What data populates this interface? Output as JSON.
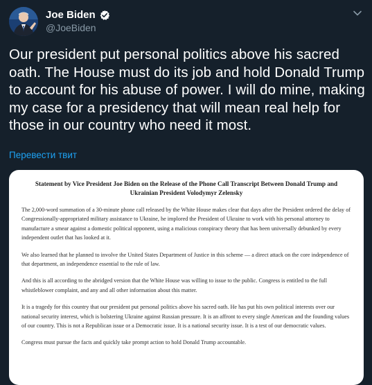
{
  "author": {
    "name": "Joe Biden",
    "handle": "@JoeBiden",
    "verified_icon": "verified-badge-icon",
    "avatar_icon": "profile-photo"
  },
  "tweet": {
    "text": "Our president put personal politics above his sacred oath. The House must do its job and hold Donald Trump to account for his abuse of power. I will do mine, making my case for a presidency that will mean real help for those in our country who need it most.",
    "translate_label": "Перевести твит"
  },
  "statement": {
    "title": "Statement by Vice President Joe Biden on the Release of the Phone Call Transcript Between Donald Trump and Ukrainian President Volodymyr Zelensky",
    "paragraphs": [
      "The 2,000-word summation of a 30-minute phone call released by the White House makes clear that days after the President ordered the delay of Congressionally-appropriated military assistance to Ukraine, he implored the President of Ukraine to work with his personal attorney to manufacture a smear against a domestic political opponent, using a malicious conspiracy theory that has been universally debunked by every independent outlet that has looked at it.",
      "We also learned that he planned to involve the United States Department of Justice in this scheme — a direct attack on the core independence of that department, an independence essential to the rule of law.",
      "And this is all according to the abridged version that the White House was willing to issue to the public. Congress is entitled to the full whistleblower complaint, and any and all other information about this matter.",
      "It is a tragedy for this country that our president put personal politics above his sacred oath. He has put his own political interests over our national security interest, which is bolstering Ukraine against Russian pressure. It is an affront to every single American and the founding values of our country. This is not a Republican issue or a Democratic issue. It is a national security issue. It is a test of our democratic values.",
      "Congress must pursue the facts and quickly take prompt action to hold Donald Trump accountable."
    ]
  },
  "colors": {
    "background": "#15202b",
    "secondary_text": "#8899a6",
    "accent": "#1da1f2"
  }
}
